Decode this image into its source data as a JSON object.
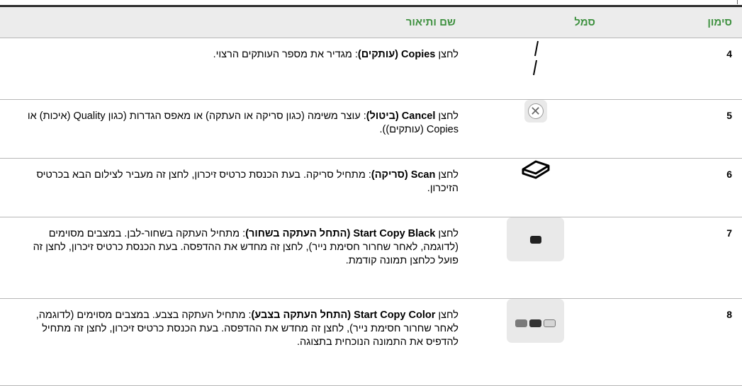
{
  "table": {
    "headers": {
      "number": "סימון",
      "symbol": "סמל",
      "description": "שם ותיאור"
    },
    "rows": [
      {
        "number": "4",
        "icon": "copies-arrows-icon",
        "prefix": "לחצן",
        "name": "Copies (עותקים)",
        "text": ": מגדיר את מספר העותקים הרצוי."
      },
      {
        "number": "5",
        "icon": "cancel-x-icon",
        "prefix": "לחצן",
        "name": "Cancel (ביטול)",
        "text": ": עוצר משימה (כגון סריקה או העתקה) או מאפס הגדרות (כגון Quality (איכות) או Copies (עותקים))."
      },
      {
        "number": "6",
        "icon": "scan-icon",
        "prefix": "לחצן",
        "name": "Scan (סריקה)",
        "text": ": מתחיל סריקה. בעת הכנסת כרטיס זיכרון, לחצן זה מעביר לצילום הבא בכרטיס הזיכרון."
      },
      {
        "number": "7",
        "icon": "start-copy-black-icon",
        "prefix": "לחצן",
        "name": "Start Copy Black (התחל העתקה בשחור)",
        "text": ": מתחיל העתקה בשחור-לבן. במצבים מסוימים (לדוגמה, לאחר שחרור חסימת נייר), לחצן זה מחדש את ההדפסה. בעת הכנסת כרטיס זיכרון, לחצן זה פועל כלחצן תמונה קודמת."
      },
      {
        "number": "8",
        "icon": "start-copy-color-icon",
        "prefix": "לחצן",
        "name": "Start Copy Color (התחל העתקה בצבע)",
        "text": ": מתחיל העתקה בצבע. במצבים מסוימים (לדוגמה, לאחר שחרור חסימת נייר), לחצן זה מחדש את ההדפסה. בעת הכנסת כרטיס זיכרון, לחצן זה מתחיל להדפיס את התמונה הנוכחית בתצוגה."
      }
    ]
  },
  "colors": {
    "header_text": "#3f9140",
    "header_bg": "#ececec",
    "rule": "#b7b7b7"
  }
}
